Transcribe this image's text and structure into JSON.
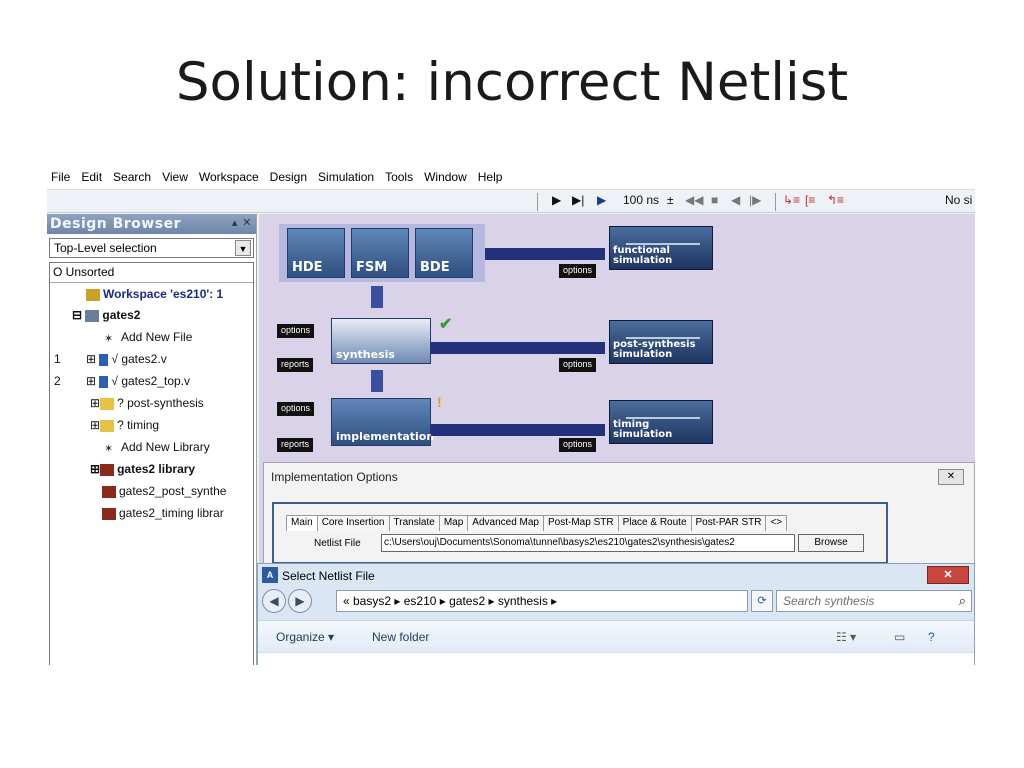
{
  "slide": {
    "title": "Solution: incorrect Netlist"
  },
  "menu": [
    "File",
    "Edit",
    "Search",
    "View",
    "Workspace",
    "Design",
    "Simulation",
    "Tools",
    "Window",
    "Help"
  ],
  "toolbar": {
    "time": "100 ns",
    "status": "No si"
  },
  "design_browser": {
    "title": "Design Browser",
    "selection": "Top-Level selection",
    "tree_header": "O  Unsorted",
    "rows": [
      {
        "num": "",
        "label": "Workspace 'es210': 1",
        "icon": "workspace-icon"
      },
      {
        "num": "",
        "label": "gates2",
        "icon": "design-icon"
      },
      {
        "num": "",
        "label": "Add New File",
        "icon": "add-file-icon"
      },
      {
        "num": "1",
        "label": "gates2.v",
        "icon": "verilog-file-icon",
        "mark": "√"
      },
      {
        "num": "2",
        "label": "gates2_top.v",
        "icon": "verilog-file-icon",
        "mark": "√"
      },
      {
        "num": "",
        "label": "post-synthesis",
        "icon": "folder-icon",
        "mark": "?"
      },
      {
        "num": "",
        "label": "timing",
        "icon": "folder-icon",
        "mark": "?"
      },
      {
        "num": "",
        "label": "Add New Library",
        "icon": "add-library-icon"
      },
      {
        "num": "",
        "label": "gates2 library",
        "icon": "library-icon"
      },
      {
        "num": "",
        "label": "gates2_post_synthe",
        "icon": "library-icon"
      },
      {
        "num": "",
        "label": "gates2_timing librar",
        "icon": "library-icon"
      }
    ]
  },
  "flow": {
    "entry_tiles": [
      "HDE",
      "FSM",
      "BDE"
    ],
    "synthesis": "synthesis",
    "implementation": "implementation",
    "sim_functional": [
      "functional",
      "simulation"
    ],
    "sim_post_synthesis": [
      "post-synthesis",
      "simulation"
    ],
    "sim_timing": [
      "timing",
      "simulation"
    ],
    "options": "options",
    "reports": "reports"
  },
  "impl_dialog": {
    "title": "Implementation Options",
    "tabs": [
      "Main",
      "Core Insertion",
      "Translate",
      "Map",
      "Advanced Map",
      "Post-Map STR",
      "Place & Route",
      "Post-PAR STR"
    ],
    "netlist_label": "Netlist File",
    "netlist_value": "c:\\Users\\ouj\\Documents\\Sonoma\\tunnel\\basys2\\es210\\gates2\\synthesis\\gates2",
    "browse": "Browse"
  },
  "select_dialog": {
    "title": "Select Netlist File",
    "address": "« basys2 ▸ es210 ▸ gates2 ▸ synthesis ▸",
    "search_placeholder": "Search synthesis",
    "organize": "Organize ▾",
    "new_folder": "New folder"
  }
}
